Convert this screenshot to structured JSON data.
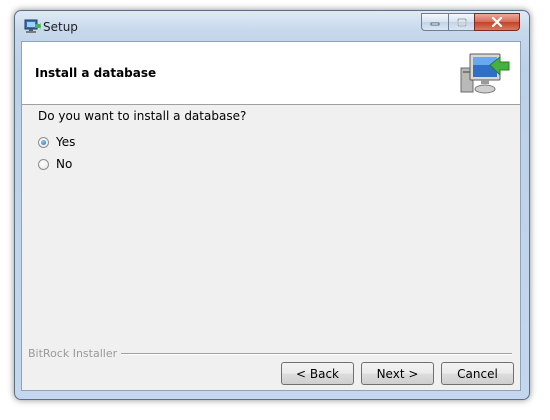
{
  "window": {
    "title": "Setup",
    "controls": {
      "minimize_icon": "minimize-icon",
      "maximize_icon": "maximize-icon",
      "close_icon": "close-icon"
    }
  },
  "header": {
    "title": "Install a database",
    "icon": "installer-computer-arrow-icon"
  },
  "question": {
    "text": "Do you want to install a database?",
    "options": [
      {
        "label": "Yes",
        "selected": true
      },
      {
        "label": "No",
        "selected": false
      }
    ]
  },
  "footer": {
    "installer_label": "BitRock Installer",
    "buttons": {
      "back": "< Back",
      "next": "Next >",
      "cancel": "Cancel"
    }
  },
  "colors": {
    "frame": "#bcd0e8",
    "close_button": "#c4412a",
    "radio_selected": "#1a5fa8"
  }
}
